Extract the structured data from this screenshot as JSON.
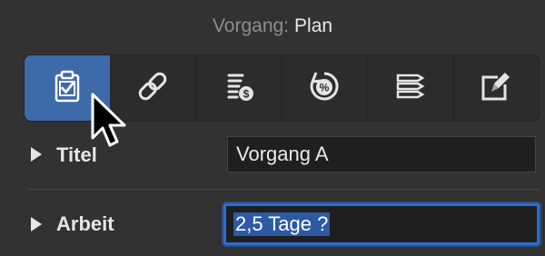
{
  "header": {
    "label": "Vorgang:",
    "value": "Plan"
  },
  "toolbar": {
    "items": [
      {
        "icon": "clipboard-check-icon",
        "active": true
      },
      {
        "icon": "link-icon",
        "active": false
      },
      {
        "icon": "cost-list-icon",
        "active": false
      },
      {
        "icon": "percent-cycle-icon",
        "active": false
      },
      {
        "icon": "list-tags-icon",
        "active": false
      },
      {
        "icon": "edit-pencil-icon",
        "active": false
      }
    ],
    "active_color": "#3d6aa8"
  },
  "fields": {
    "title": {
      "label": "Titel",
      "value": "Vorgang A"
    },
    "work": {
      "label": "Arbeit",
      "value": "2,5 Tage ?"
    }
  },
  "colors": {
    "background": "#323232",
    "focus_ring": "#2f6bd1",
    "selection": "#2e5aa3"
  }
}
